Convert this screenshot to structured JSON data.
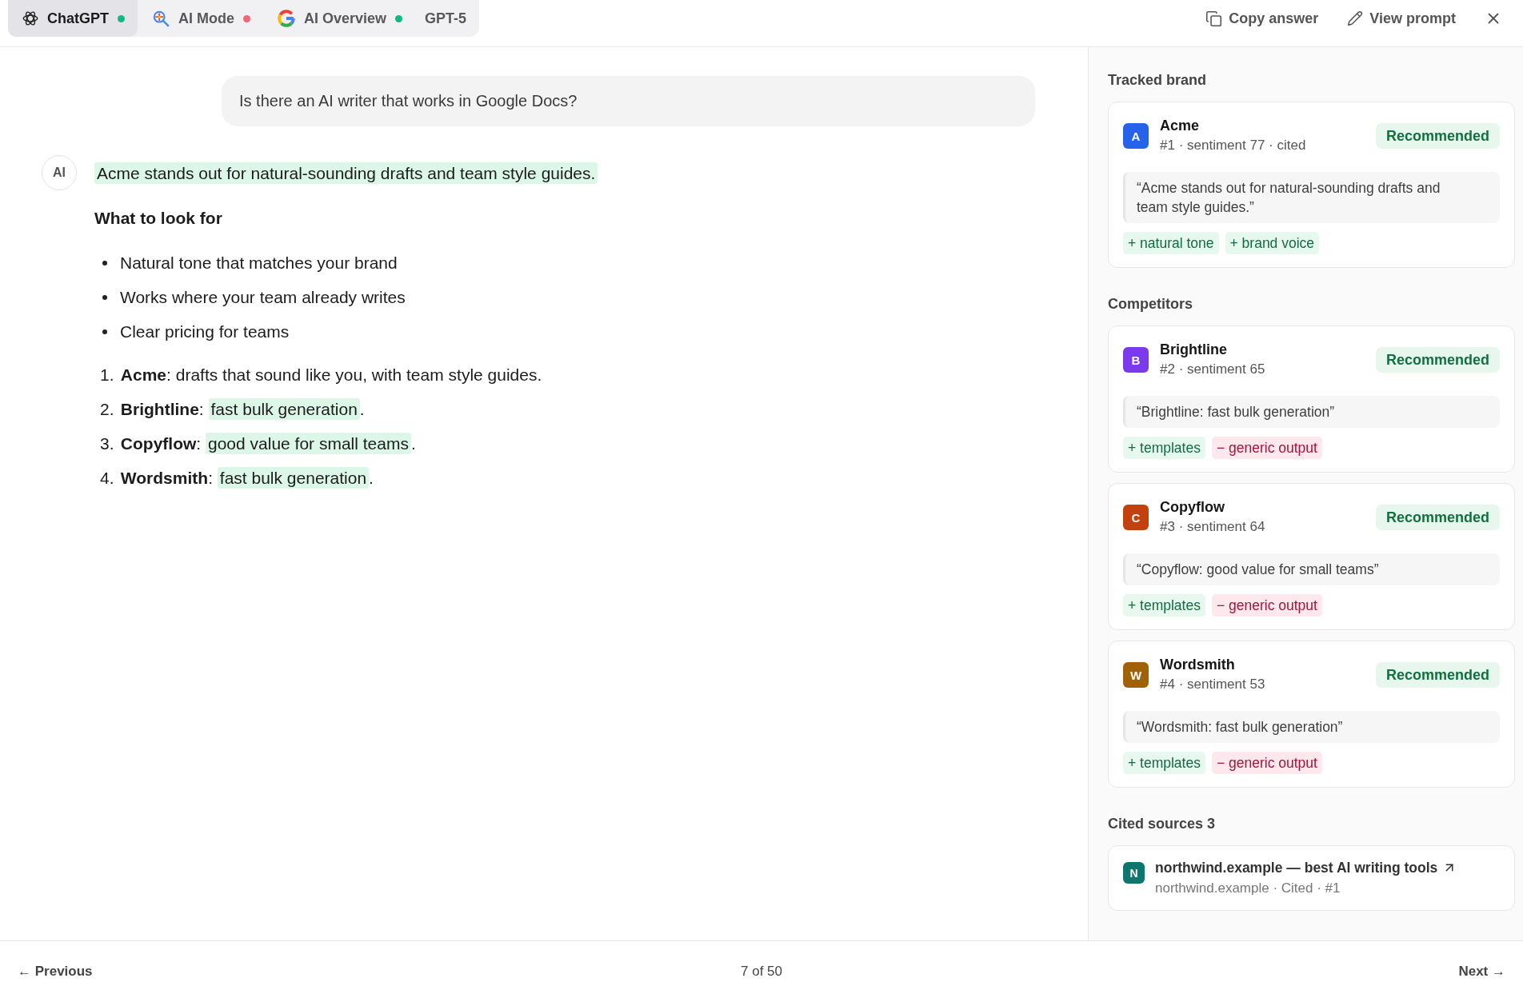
{
  "tabs": [
    {
      "label": "ChatGPT",
      "selected": true,
      "color": "#10b981"
    },
    {
      "label": "AI Mode",
      "selected": false,
      "color": "#f0677a"
    },
    {
      "label": "AI Overview",
      "selected": false,
      "color": "#10b981"
    }
  ],
  "model": "GPT-5",
  "actions": [
    {
      "label": "Copy answer"
    },
    {
      "label": "View prompt"
    }
  ],
  "prompt": "Is there an AI writer that works in Google Docs?",
  "answer": {
    "avatar": "AI",
    "summary": {
      "text": "Acme stands out for natural-sounding drafts and team style guides.",
      "highlighted": true
    },
    "heading": "What to look for",
    "bullets": [
      "Natural tone that matches your brand",
      "Works where your team already writes",
      "Clear pricing for teams"
    ],
    "ranked": [
      {
        "number": "1.",
        "label": "**Acme**: ",
        "text": "drafts that sound like you, with team style guides",
        "highlighted": false,
        "suffix": "."
      },
      {
        "number": "2.",
        "label": "**Brightline**: ",
        "text": "fast bulk generation",
        "highlighted": true,
        "suffix": "."
      },
      {
        "number": "3.",
        "label": "**Copyflow**: ",
        "text": "good value for small teams",
        "highlighted": true,
        "suffix": "."
      },
      {
        "number": "4.",
        "label": "**Wordsmith**: ",
        "text": "fast bulk generation",
        "highlighted": true,
        "suffix": "."
      }
    ]
  },
  "tracked_brand": {
    "title": "Tracked brand",
    "brands": [
      {
        "initial": "A",
        "color": "#2563eb",
        "name": "Acme",
        "meta": "#1 · sentiment 77 · cited",
        "status": "Recommended",
        "quote": "“Acme stands out for natural-sounding drafts and team style guides.”",
        "tags": [
          {
            "label": "+ natural tone",
            "kind": "positive"
          },
          {
            "label": "+ brand voice",
            "kind": "positive"
          }
        ]
      }
    ]
  },
  "competitors": {
    "title": "Competitors",
    "brands": [
      {
        "initial": "B",
        "color": "#7c3aed",
        "name": "Brightline",
        "meta": "#2 · sentiment 65",
        "status": "Recommended",
        "quote": "“Brightline: fast bulk generation”",
        "tags": [
          {
            "label": "+ templates",
            "kind": "positive"
          },
          {
            "label": "− generic output",
            "kind": "negative"
          }
        ]
      },
      {
        "initial": "C",
        "color": "#c2410c",
        "name": "Copyflow",
        "meta": "#3 · sentiment 64",
        "status": "Recommended",
        "quote": "“Copyflow: good value for small teams”",
        "tags": [
          {
            "label": "+ templates",
            "kind": "positive"
          },
          {
            "label": "− generic output",
            "kind": "negative"
          }
        ]
      },
      {
        "initial": "W",
        "color": "#a16207",
        "name": "Wordsmith",
        "meta": "#4 · sentiment 53",
        "status": "Recommended",
        "quote": "“Wordsmith: fast bulk generation”",
        "tags": [
          {
            "label": "+ templates",
            "kind": "positive"
          },
          {
            "label": "− generic output",
            "kind": "negative"
          }
        ]
      }
    ]
  },
  "cited_sources": {
    "title": "Cited sources 3",
    "sources": [
      {
        "initial": "N",
        "color": "#0f766e",
        "title": "northwind.example — best AI writing tools",
        "meta": "northwind.example · Cited · #1"
      }
    ]
  },
  "pagination": {
    "previous": "← Previous",
    "page": "7 of 50",
    "next": "Next →"
  }
}
